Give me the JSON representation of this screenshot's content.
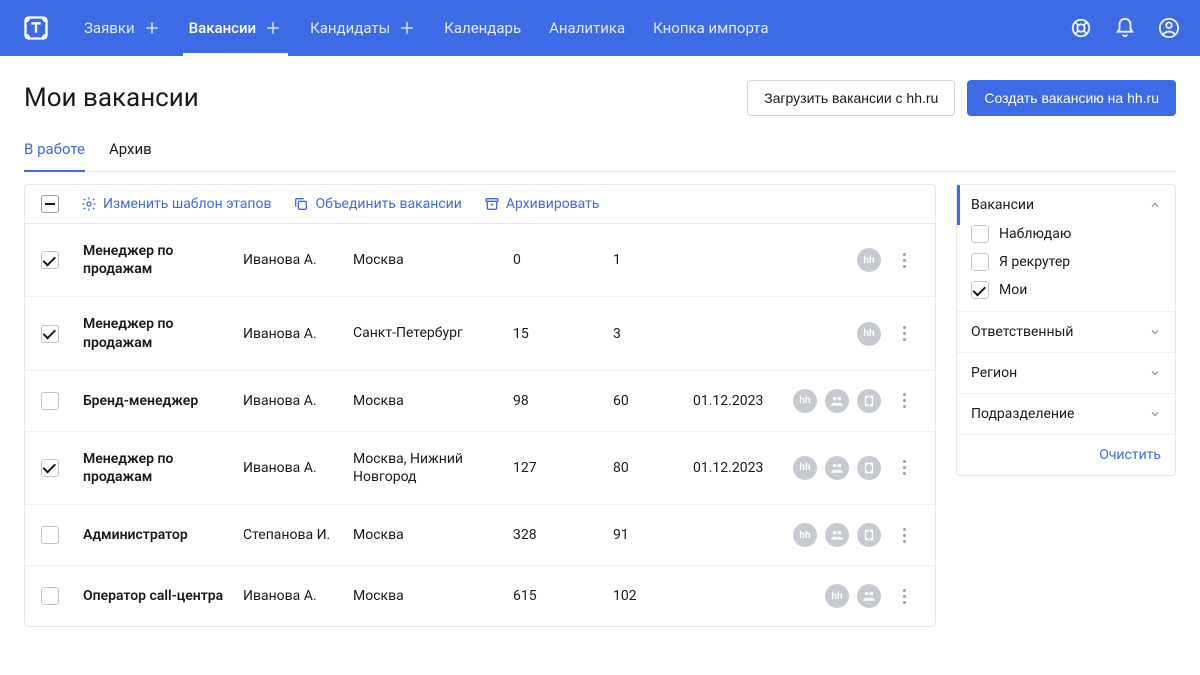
{
  "nav": {
    "items": [
      {
        "label": "Заявки",
        "add": true
      },
      {
        "label": "Вакансии",
        "add": true,
        "active": true
      },
      {
        "label": "Кандидаты",
        "add": true
      },
      {
        "label": "Календарь"
      },
      {
        "label": "Аналитика"
      },
      {
        "label": "Кнопка импорта"
      }
    ]
  },
  "page": {
    "title": "Мои вакансии",
    "load_btn": "Загрузить вакансии с hh.ru",
    "create_btn": "Создать вакансию на hh.ru"
  },
  "tabs": [
    {
      "label": "В работе",
      "active": true
    },
    {
      "label": "Архив"
    }
  ],
  "bulk": {
    "edit_stages": "Изменить шаблон этапов",
    "merge": "Объединить вакансии",
    "archive": "Архивировать"
  },
  "rows": [
    {
      "checked": true,
      "title": "Менеджер по продажам",
      "owner": "Иванова А.",
      "region": "Москва",
      "n1": "0",
      "n2": "1",
      "date": "",
      "sources": [
        "hh"
      ]
    },
    {
      "checked": true,
      "title": "Менеджер по продажам",
      "owner": "Иванова А.",
      "region": "Санкт-Петербург",
      "n1": "15",
      "n2": "3",
      "date": "",
      "sources": [
        "hh"
      ]
    },
    {
      "checked": false,
      "title": "Бренд-менеджер",
      "owner": "Иванова А.",
      "region": "Москва",
      "n1": "98",
      "n2": "60",
      "date": "01.12.2023",
      "sources": [
        "hh",
        "people",
        "shape"
      ]
    },
    {
      "checked": true,
      "title": "Менеджер по продажам",
      "owner": "Иванова А.",
      "region": "Москва, Нижний Новгород",
      "n1": "127",
      "n2": "80",
      "date": "01.12.2023",
      "sources": [
        "hh",
        "people",
        "shape"
      ]
    },
    {
      "checked": false,
      "title": "Администратор",
      "owner": "Степанова И.",
      "region": "Москва",
      "n1": "328",
      "n2": "91",
      "date": "",
      "sources": [
        "hh",
        "people",
        "shape"
      ]
    },
    {
      "checked": false,
      "title": "Оператор call-центра",
      "owner": "Иванова А.",
      "region": "Москва",
      "n1": "615",
      "n2": "102",
      "date": "",
      "sources": [
        "hh",
        "people"
      ]
    }
  ],
  "sidebar": {
    "sections": [
      {
        "title": "Вакансии",
        "open": true,
        "active": true,
        "options": [
          {
            "label": "Наблюдаю",
            "checked": false
          },
          {
            "label": "Я рекрутер",
            "checked": false
          },
          {
            "label": "Мои",
            "checked": true
          }
        ]
      },
      {
        "title": "Ответственный",
        "open": false
      },
      {
        "title": "Регион",
        "open": false
      },
      {
        "title": "Подразделение",
        "open": false
      }
    ],
    "clear": "Очистить"
  }
}
